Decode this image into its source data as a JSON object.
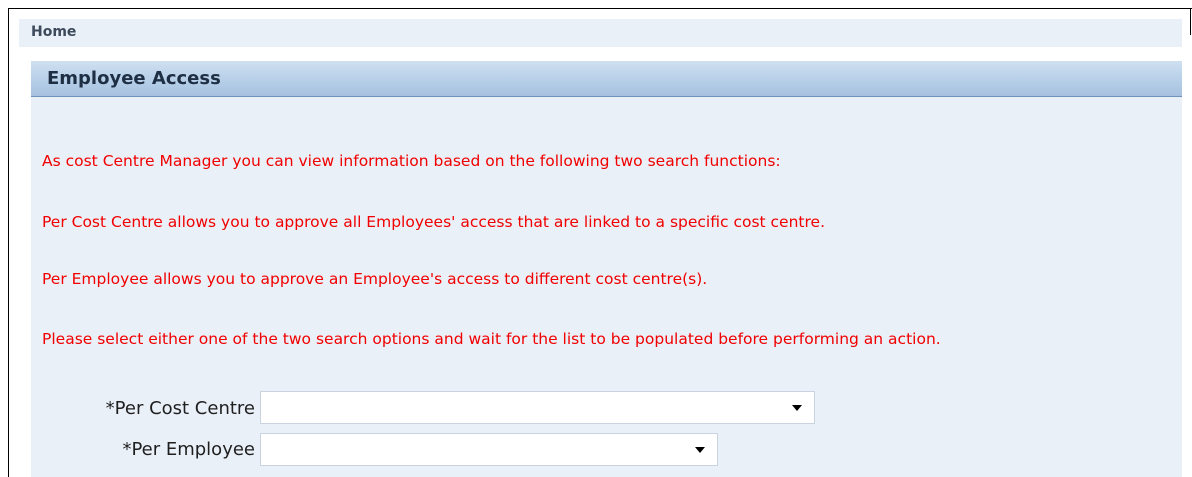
{
  "breadcrumb": {
    "home": "Home"
  },
  "page": {
    "title": "Employee Access"
  },
  "messages": [
    "As cost Centre Manager you can view information based on the following two search functions:",
    "Per Cost Centre allows you to approve all Employees' access that are linked to a specific cost centre.",
    "Per Employee allows you to approve an Employee's access to different cost centre(s).",
    "Please select either one of the two search options and wait for the list to be populated before performing an action."
  ],
  "form": {
    "cost_centre": {
      "label": "*Per Cost Centre",
      "value": ""
    },
    "employee": {
      "label": "*Per Employee",
      "value": ""
    }
  },
  "colors": {
    "message": "#f00000",
    "header_gradient_top": "#cfe0f0",
    "header_gradient_bottom": "#a6c1df",
    "panel_background": "#eaf0f8"
  }
}
